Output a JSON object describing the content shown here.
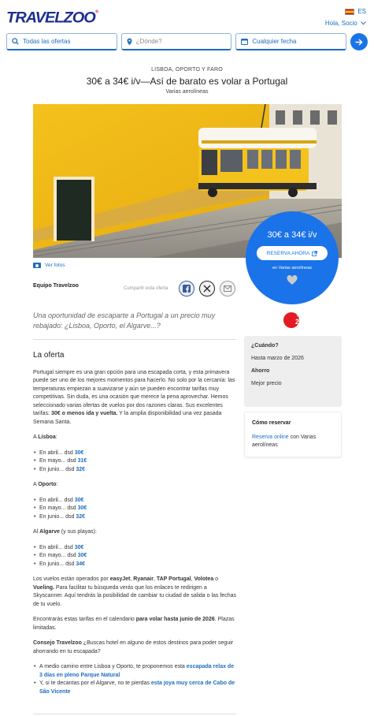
{
  "header": {
    "logo": "TRAVELZOO",
    "language": "ES",
    "greeting": "Hola, Socio"
  },
  "search": {
    "deals_label": "Todas las ofertas",
    "where_placeholder": "¿Dónde?",
    "date_label": "Cualquier fecha"
  },
  "deal": {
    "kicker": "LISBOA, OPORTO Y FARO",
    "title": "30€ a 34€ i/v—Así de barato es volar a Portugal",
    "subtitle": "Varias aerolíneas",
    "view_photos": "Ver fotos",
    "price": "30€ a 34€ i/v",
    "cta": "RESERVA AHORA",
    "cta_note": "en Varias aerolíneas"
  },
  "author": {
    "name": "Equipo Travelzoo",
    "share_label": "Compartir esta oferta"
  },
  "lede": "Una oportunidad de escaparte a Portugal a un precio muy rebajado: ¿Lisboa, Oporto, el Algarve...?",
  "badge": {
    "small": "TOP",
    "big": "20"
  },
  "sidebar": {
    "when_heading": "¿Cuándo?",
    "when_value": "Hasta marzo de 2026",
    "saving_heading": "Ahorro",
    "saving_value": "Mejor precio",
    "book_heading": "Cómo reservar",
    "book_link": "Reserva online",
    "book_rest": " con Varias aerolíneas"
  },
  "article": {
    "heading": "La oferta",
    "intro_a": "Portugal siempre es una gran opción para una escapada corta, y esta primavera puede ser uno de los mejores momentos para hacerlo. No solo por la cercanía: las temperaturas empiezan a suavizarse y aún se pueden encontrar tarifas muy competitivas. Sin duda, es una ocasión que merece la pena aprovechar. Hemos seleccionado varias ofertas de vuelos por dos razones claras. Sus excelentes tarifas: ",
    "intro_bold": "30€ o menos ida y vuelta.",
    "intro_b": " Y la amplia disponibilidad una vez pasada Semana Santa.",
    "cities": [
      {
        "prefix": "A ",
        "name": "Lisboa",
        "suffix": ":",
        "fares": [
          {
            "label": "En abril... dsd ",
            "price": "30€"
          },
          {
            "label": "En mayo... dsd ",
            "price": "31€"
          },
          {
            "label": "En junio... dsd ",
            "price": "32€"
          }
        ]
      },
      {
        "prefix": "A ",
        "name": "Oporto",
        "suffix": ":",
        "fares": [
          {
            "label": "En abril... dsd ",
            "price": "30€"
          },
          {
            "label": "En mayo... dsd ",
            "price": "30€"
          },
          {
            "label": "En junio... dsd ",
            "price": "32€"
          }
        ]
      },
      {
        "prefix": "Al ",
        "name": "Algarve",
        "suffix": " (y sus playas):",
        "fares": [
          {
            "label": "En abril... dsd ",
            "price": "30€"
          },
          {
            "label": "En mayo... dsd ",
            "price": "30€"
          },
          {
            "label": "En junio... dsd ",
            "price": "34€"
          }
        ]
      }
    ],
    "airlines_intro": "Los vuelos están operados por ",
    "airline_1": "easyJet",
    "airline_2": "Ryanair",
    "airline_3": "TAP Portugal",
    "airline_4": "Volotea",
    "airline_5": "Vueling.",
    "airlines_rest": " Para facilitar tu búsqueda verás que los enlaces te redirigen a Skyscanner. Aquí tendrás la posibilidad de cambiar tu ciudad de salida o las fechas de tu vuelo.",
    "calendar_a": "Encontrarás estas tarifas en el calendario ",
    "calendar_bold": "para volar hasta junio de 2026",
    "calendar_b": ". Plazas limitadas.",
    "tip_label": "Consejo Travelzoo",
    "tip_text": " ¿Buscas hotel en alguno de estos destinos para poder seguir ahorrando en tu escapada?",
    "tip_1_text": "A medio camino entre Lisboa y Oporto, te proponemos esta ",
    "tip_1_link": "escapada relax de 3 días en pleno Parque Natural",
    "tip_2_text": "Y, si te decantas por el Algarve, no te pierdas ",
    "tip_2_link": "esta joya muy cerca de Cabo de São Vicente"
  }
}
